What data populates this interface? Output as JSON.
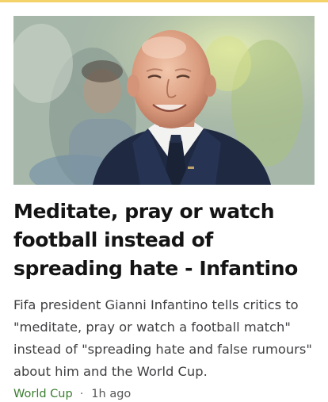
{
  "article": {
    "image_alt": "Gianni Infantino smiling",
    "headline": "Meditate, pray or watch football instead of spreading hate - Infantino",
    "summary": "Fifa president Gianni Infantino tells critics to \"meditate, pray or watch a football match\" instead of \"spreading hate and false rumours\" about him and the World Cup.",
    "topic": "World Cup",
    "separator": "·",
    "timestamp": "1h ago"
  },
  "colors": {
    "top_accent": "#f5d36b",
    "headline": "#141414",
    "summary": "#3f3f42",
    "topic": "#3a7c2f",
    "meta": "#545658"
  }
}
